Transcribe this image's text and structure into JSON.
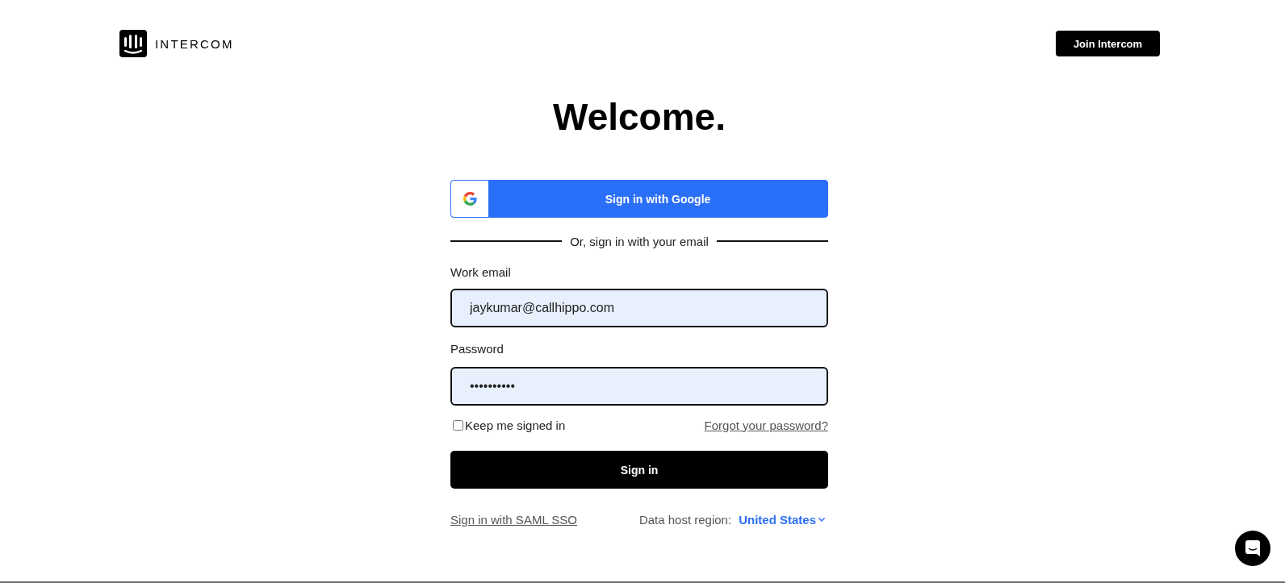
{
  "header": {
    "logo_text": "INTERCOM",
    "join_button": "Join Intercom"
  },
  "heading": "Welcome.",
  "google_button": {
    "label": "Sign in with Google"
  },
  "divider_text": "Or, sign in with your email",
  "fields": [
    {
      "label": "Work email",
      "value": "jaykumar@callhippo.com"
    },
    {
      "label": "Password",
      "value": "••••••••••"
    }
  ],
  "remember": {
    "label": "Keep me signed in",
    "checked": false
  },
  "forgot_link": "Forgot your password?",
  "submit_button": "Sign in",
  "saml_link": "Sign in with SAML SSO",
  "region": {
    "label": "Data host region:",
    "value": "United States"
  }
}
